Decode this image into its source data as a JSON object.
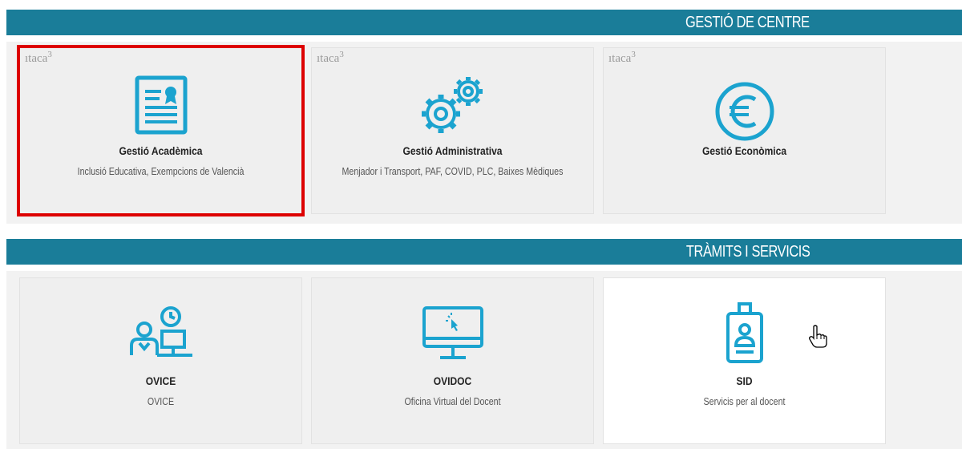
{
  "sections": [
    {
      "title": "GESTIÓ DE CENTRE",
      "cards": [
        {
          "brand": "ıtaca",
          "brand_sup": "3",
          "icon": "certificate-document-icon",
          "title": "Gestió Acadèmica",
          "subtitle": "Inclusió Educativa, Exempcions de Valencià",
          "selected": true
        },
        {
          "brand": "ıtaca",
          "brand_sup": "3",
          "icon": "gears-icon",
          "title": "Gestió Administrativa",
          "subtitle": "Menjador i Transport, PAF, COVID, PLC, Baixes Mèdiques"
        },
        {
          "brand": "ıtaca",
          "brand_sup": "3",
          "icon": "euro-icon",
          "title": "Gestió Econòmica",
          "subtitle": ""
        }
      ]
    },
    {
      "title": "TRÀMITS I SERVICIS",
      "cards": [
        {
          "icon": "office-worker-clock-icon",
          "title": "OVICE",
          "subtitle": "OVICE"
        },
        {
          "icon": "monitor-click-icon",
          "title": "OVIDOC",
          "subtitle": "Oficina Virtual del Docent"
        },
        {
          "icon": "id-badge-icon",
          "title": "SID",
          "subtitle": "Servicis per al docent"
        }
      ]
    }
  ],
  "colors": {
    "header": "#1a7d99",
    "icon": "#1ba3cf",
    "selected_outline": "#dd0000"
  }
}
